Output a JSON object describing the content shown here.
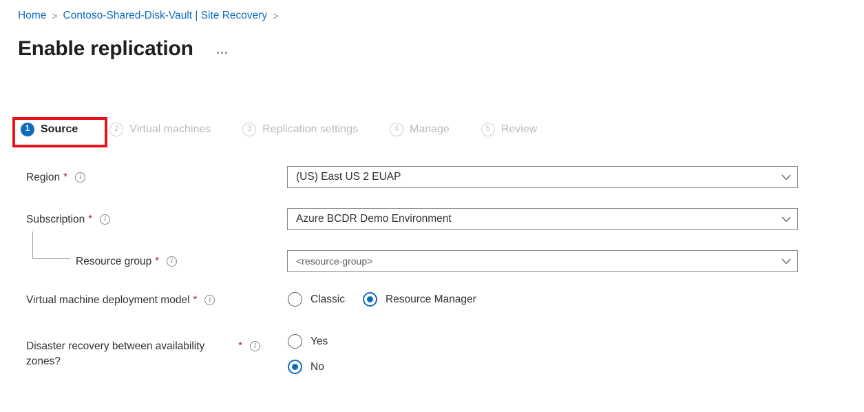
{
  "breadcrumb": {
    "items": [
      {
        "label": "Home"
      },
      {
        "label": "Contoso-Shared-Disk-Vault | Site Recovery"
      }
    ],
    "separator": ">"
  },
  "header": {
    "title": "Enable replication",
    "more_label": "more-options"
  },
  "wizard": {
    "steps": [
      {
        "number": "1",
        "label": "Source",
        "state": "active"
      },
      {
        "number": "2",
        "label": "Virtual machines",
        "state": "inactive"
      },
      {
        "number": "3",
        "label": "Replication settings",
        "state": "inactive"
      },
      {
        "number": "4",
        "label": "Manage",
        "state": "inactive"
      },
      {
        "number": "5",
        "label": "Review",
        "state": "inactive"
      }
    ]
  },
  "form": {
    "region": {
      "label": "Region",
      "required_marker": "*",
      "value": "(US) East US 2 EUAP"
    },
    "subscription": {
      "label": "Subscription",
      "required_marker": "*",
      "value": "Azure BCDR Demo Environment"
    },
    "resource_group": {
      "label": "Resource group",
      "required_marker": "*",
      "value": "<resource-group>"
    },
    "deployment_model": {
      "label": "Virtual machine deployment model",
      "required_marker": "*",
      "options": [
        {
          "label": "Classic",
          "checked": false
        },
        {
          "label": "Resource Manager",
          "checked": true
        }
      ]
    },
    "availability_zones": {
      "label": "Disaster recovery between availability zones?",
      "required_marker": "*",
      "options": [
        {
          "label": "Yes",
          "checked": false
        },
        {
          "label": "No",
          "checked": true
        }
      ]
    }
  },
  "icons": {
    "info": "i",
    "chevron_down": "chevron-down-icon"
  },
  "colors": {
    "accent_blue": "#0f6cbd",
    "link_blue": "#0f6cbd",
    "required_red": "#a4262c",
    "annotation_red": "#e8121b",
    "text_primary": "#323130",
    "text_disabled": "#bdbbb9",
    "border_gray": "#8a8886"
  }
}
